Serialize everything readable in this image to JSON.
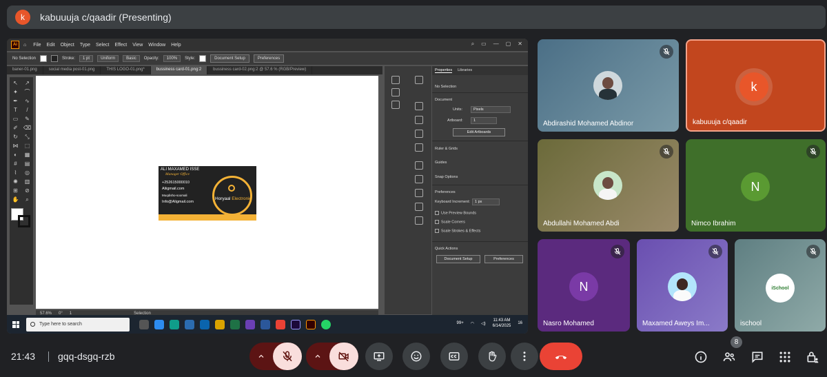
{
  "presenter_bar": {
    "avatar_letter": "k",
    "title": "kabuuuja c/qaadir (Presenting)"
  },
  "illustrator": {
    "menus": [
      "File",
      "Edit",
      "Object",
      "Type",
      "Select",
      "Effect",
      "View",
      "Window",
      "Help"
    ],
    "control": {
      "selection": "No Selection",
      "stroke_label": "Stroke:",
      "stroke_value": "1 pt",
      "profile": "Uniform",
      "brush": "Basic",
      "opacity_label": "Opacity:",
      "opacity_value": "100%",
      "style_label": "Style:",
      "doc_setup": "Document Setup",
      "preferences": "Preferences"
    },
    "tabs": [
      "baner-01.png",
      "social media post-01.png",
      "THIS LOGO-01.png*",
      "bussiness card-01.png:2",
      "bussiness card-02.png:2 @ 57.6 % (RGB/Preview)"
    ],
    "card": {
      "name": "ALI MAXAMED ISSE",
      "role": "Manager Office",
      "phone": "+252615000010",
      "email1": "Aliigmail.com",
      "address": "Muqdisho-soomali",
      "email2": "Info@Aligmail.com",
      "brand_a": "Horyaal ",
      "brand_b": "Electronic"
    },
    "status": {
      "zoom": "57.6%",
      "rotate": "0°",
      "artboard": "1",
      "tool": "Selection"
    },
    "panel": {
      "tab_properties": "Properties",
      "tab_libraries": "Libraries",
      "no_selection": "No Selection",
      "document": "Document",
      "units_label": "Units:",
      "units_value": "Pixels",
      "artboard_label": "Artboard:",
      "artboard_value": "1",
      "edit_artboards": "Edit Artboards",
      "rulers": "Ruler & Grids",
      "guides": "Guides",
      "snap": "Snap Options",
      "preferences": "Preferences",
      "keyboard_label": "Keyboard Increment:",
      "keyboard_value": "1 px",
      "cb1": "Use Preview Bounds",
      "cb2": "Scale Corners",
      "cb3": "Scale Strokes & Effects",
      "quick_actions": "Quick Actions",
      "doc_setup": "Document Setup",
      "prefs_btn": "Preferences"
    }
  },
  "taskbar": {
    "search_placeholder": "Type here to search",
    "weather_badge": "99+",
    "time": "11:43 AM",
    "date": "6/14/2025",
    "notif": "16"
  },
  "participants": [
    {
      "name": "Abdirashid Mohamed Abdinor",
      "muted": true
    },
    {
      "name": "kabuuuja c/qaadir",
      "letter": "k",
      "muted": false
    },
    {
      "name": "Abdullahi Mohamed Abdi",
      "muted": true
    },
    {
      "name": "Nimco Ibrahim",
      "letter": "N",
      "muted": true
    },
    {
      "name": "Nasro Mohamed",
      "letter": "N",
      "muted": true
    },
    {
      "name": "Maxamed Aweys Im...",
      "muted": true
    },
    {
      "name": "ischool",
      "logo_text": "iSchool",
      "muted": true
    }
  ],
  "bottom_bar": {
    "clock": "21:43",
    "meeting_code": "gqq-dsgq-rzb",
    "people_count": "8"
  },
  "colors": {
    "end_call": "#ea4335",
    "tile_kabuuuja": "#c2461e",
    "avatar_k": "#e8562a",
    "tile_nimco": "#3f6f2a",
    "tile_nasro": "#5b2a7e"
  }
}
